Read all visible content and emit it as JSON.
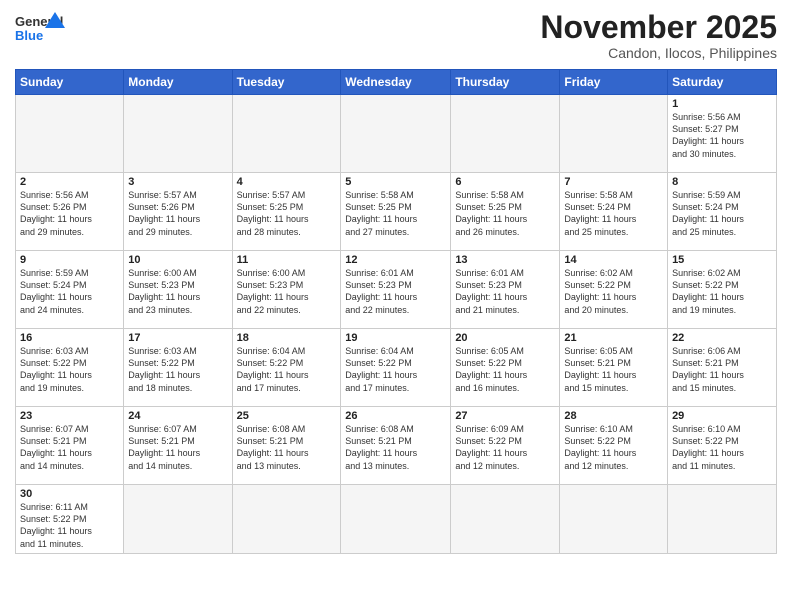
{
  "header": {
    "logo_general": "General",
    "logo_blue": "Blue",
    "month_title": "November 2025",
    "location": "Candon, Ilocos, Philippines"
  },
  "weekdays": [
    "Sunday",
    "Monday",
    "Tuesday",
    "Wednesday",
    "Thursday",
    "Friday",
    "Saturday"
  ],
  "weeks": [
    [
      {
        "day": "",
        "info": ""
      },
      {
        "day": "",
        "info": ""
      },
      {
        "day": "",
        "info": ""
      },
      {
        "day": "",
        "info": ""
      },
      {
        "day": "",
        "info": ""
      },
      {
        "day": "",
        "info": ""
      },
      {
        "day": "1",
        "info": "Sunrise: 5:56 AM\nSunset: 5:27 PM\nDaylight: 11 hours\nand 30 minutes."
      }
    ],
    [
      {
        "day": "2",
        "info": "Sunrise: 5:56 AM\nSunset: 5:26 PM\nDaylight: 11 hours\nand 29 minutes."
      },
      {
        "day": "3",
        "info": "Sunrise: 5:57 AM\nSunset: 5:26 PM\nDaylight: 11 hours\nand 29 minutes."
      },
      {
        "day": "4",
        "info": "Sunrise: 5:57 AM\nSunset: 5:25 PM\nDaylight: 11 hours\nand 28 minutes."
      },
      {
        "day": "5",
        "info": "Sunrise: 5:58 AM\nSunset: 5:25 PM\nDaylight: 11 hours\nand 27 minutes."
      },
      {
        "day": "6",
        "info": "Sunrise: 5:58 AM\nSunset: 5:25 PM\nDaylight: 11 hours\nand 26 minutes."
      },
      {
        "day": "7",
        "info": "Sunrise: 5:58 AM\nSunset: 5:24 PM\nDaylight: 11 hours\nand 25 minutes."
      },
      {
        "day": "8",
        "info": "Sunrise: 5:59 AM\nSunset: 5:24 PM\nDaylight: 11 hours\nand 25 minutes."
      }
    ],
    [
      {
        "day": "9",
        "info": "Sunrise: 5:59 AM\nSunset: 5:24 PM\nDaylight: 11 hours\nand 24 minutes."
      },
      {
        "day": "10",
        "info": "Sunrise: 6:00 AM\nSunset: 5:23 PM\nDaylight: 11 hours\nand 23 minutes."
      },
      {
        "day": "11",
        "info": "Sunrise: 6:00 AM\nSunset: 5:23 PM\nDaylight: 11 hours\nand 22 minutes."
      },
      {
        "day": "12",
        "info": "Sunrise: 6:01 AM\nSunset: 5:23 PM\nDaylight: 11 hours\nand 22 minutes."
      },
      {
        "day": "13",
        "info": "Sunrise: 6:01 AM\nSunset: 5:23 PM\nDaylight: 11 hours\nand 21 minutes."
      },
      {
        "day": "14",
        "info": "Sunrise: 6:02 AM\nSunset: 5:22 PM\nDaylight: 11 hours\nand 20 minutes."
      },
      {
        "day": "15",
        "info": "Sunrise: 6:02 AM\nSunset: 5:22 PM\nDaylight: 11 hours\nand 19 minutes."
      }
    ],
    [
      {
        "day": "16",
        "info": "Sunrise: 6:03 AM\nSunset: 5:22 PM\nDaylight: 11 hours\nand 19 minutes."
      },
      {
        "day": "17",
        "info": "Sunrise: 6:03 AM\nSunset: 5:22 PM\nDaylight: 11 hours\nand 18 minutes."
      },
      {
        "day": "18",
        "info": "Sunrise: 6:04 AM\nSunset: 5:22 PM\nDaylight: 11 hours\nand 17 minutes."
      },
      {
        "day": "19",
        "info": "Sunrise: 6:04 AM\nSunset: 5:22 PM\nDaylight: 11 hours\nand 17 minutes."
      },
      {
        "day": "20",
        "info": "Sunrise: 6:05 AM\nSunset: 5:22 PM\nDaylight: 11 hours\nand 16 minutes."
      },
      {
        "day": "21",
        "info": "Sunrise: 6:05 AM\nSunset: 5:21 PM\nDaylight: 11 hours\nand 15 minutes."
      },
      {
        "day": "22",
        "info": "Sunrise: 6:06 AM\nSunset: 5:21 PM\nDaylight: 11 hours\nand 15 minutes."
      }
    ],
    [
      {
        "day": "23",
        "info": "Sunrise: 6:07 AM\nSunset: 5:21 PM\nDaylight: 11 hours\nand 14 minutes."
      },
      {
        "day": "24",
        "info": "Sunrise: 6:07 AM\nSunset: 5:21 PM\nDaylight: 11 hours\nand 14 minutes."
      },
      {
        "day": "25",
        "info": "Sunrise: 6:08 AM\nSunset: 5:21 PM\nDaylight: 11 hours\nand 13 minutes."
      },
      {
        "day": "26",
        "info": "Sunrise: 6:08 AM\nSunset: 5:21 PM\nDaylight: 11 hours\nand 13 minutes."
      },
      {
        "day": "27",
        "info": "Sunrise: 6:09 AM\nSunset: 5:22 PM\nDaylight: 11 hours\nand 12 minutes."
      },
      {
        "day": "28",
        "info": "Sunrise: 6:10 AM\nSunset: 5:22 PM\nDaylight: 11 hours\nand 12 minutes."
      },
      {
        "day": "29",
        "info": "Sunrise: 6:10 AM\nSunset: 5:22 PM\nDaylight: 11 hours\nand 11 minutes."
      }
    ],
    [
      {
        "day": "30",
        "info": "Sunrise: 6:11 AM\nSunset: 5:22 PM\nDaylight: 11 hours\nand 11 minutes."
      },
      {
        "day": "",
        "info": ""
      },
      {
        "day": "",
        "info": ""
      },
      {
        "day": "",
        "info": ""
      },
      {
        "day": "",
        "info": ""
      },
      {
        "day": "",
        "info": ""
      },
      {
        "day": "",
        "info": ""
      }
    ]
  ]
}
